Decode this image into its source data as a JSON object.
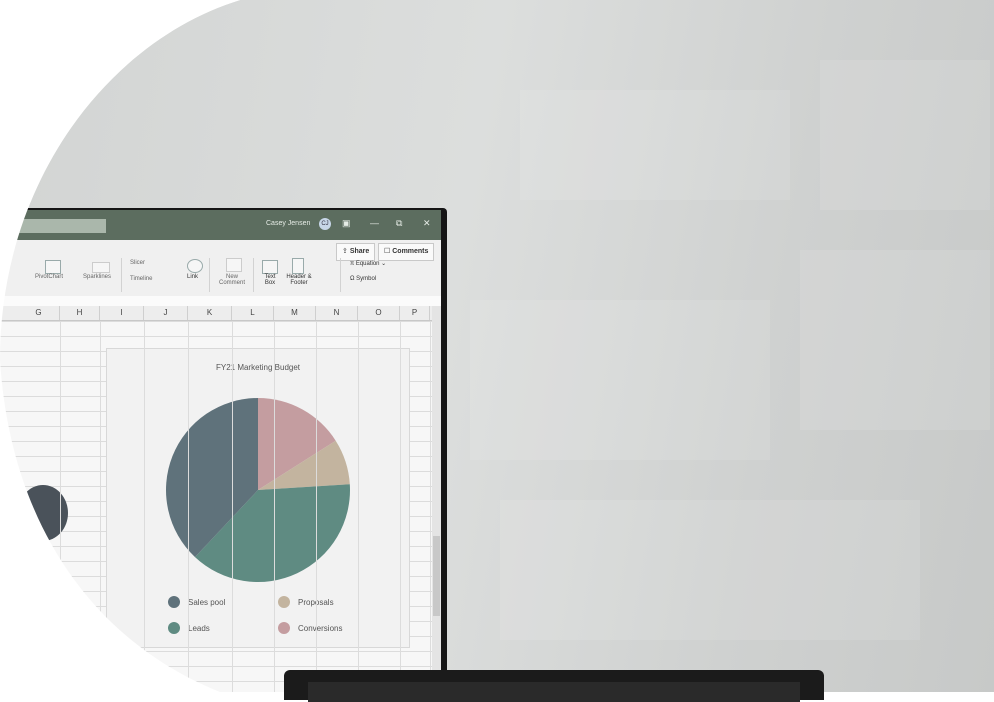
{
  "window": {
    "user_name": "Casey Jensen",
    "avatar_initials": "CJ",
    "min_glyph": "—",
    "restore_glyph": "⧉",
    "close_glyph": "✕",
    "ribbon_toggle_glyph": "▣"
  },
  "ribbon": {
    "share_label": "Share",
    "comments_label": "Comments",
    "items": {
      "a": "a",
      "pivotchart": "PivotChart",
      "sparklines": "Sparklines",
      "slicer": "Slicer",
      "timeline": "Timeline",
      "link": "Link",
      "new_comment": "New Comment",
      "text_box": "Text Box",
      "header_footer": "Header & Footer",
      "equation": "Equation",
      "symbol": "Symbol"
    }
  },
  "columns": [
    "G",
    "H",
    "I",
    "J",
    "K",
    "L",
    "M",
    "N",
    "O",
    "P"
  ],
  "chart_data": {
    "type": "pie",
    "title": "FY21 Marketing Budget",
    "categories": [
      "Sales pool",
      "Proposals",
      "Leads",
      "Conversions"
    ],
    "values": [
      38,
      8,
      38,
      16
    ],
    "colors": {
      "Sales pool": "#5f727b",
      "Leads": "#5f8b82",
      "Proposals": "#c3b49f",
      "Conversions": "#c49da0"
    }
  }
}
